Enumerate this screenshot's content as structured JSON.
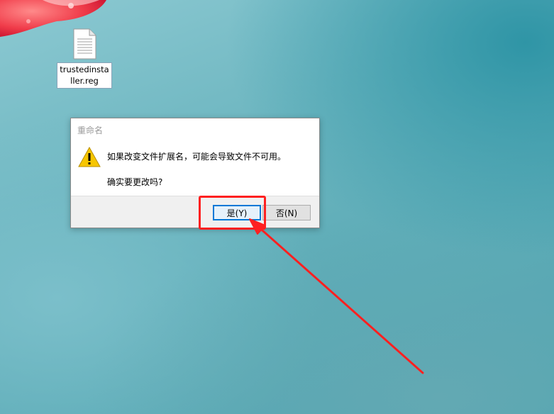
{
  "desktop": {
    "icon": {
      "name": "trustedinstaller.reg",
      "label": "trustedinstaller.reg",
      "glyph": "file-icon"
    }
  },
  "dialog": {
    "title": "重命名",
    "icon": "warning-icon",
    "message_line1": "如果改变文件扩展名，可能会导致文件不可用。",
    "message_line2": "确实要更改吗?",
    "buttons": {
      "yes_label": "是(Y)",
      "no_label": "否(N)"
    }
  },
  "colors": {
    "highlight": "#ff2020",
    "default_button_border": "#0078d7",
    "warning_yellow": "#f7c600"
  }
}
